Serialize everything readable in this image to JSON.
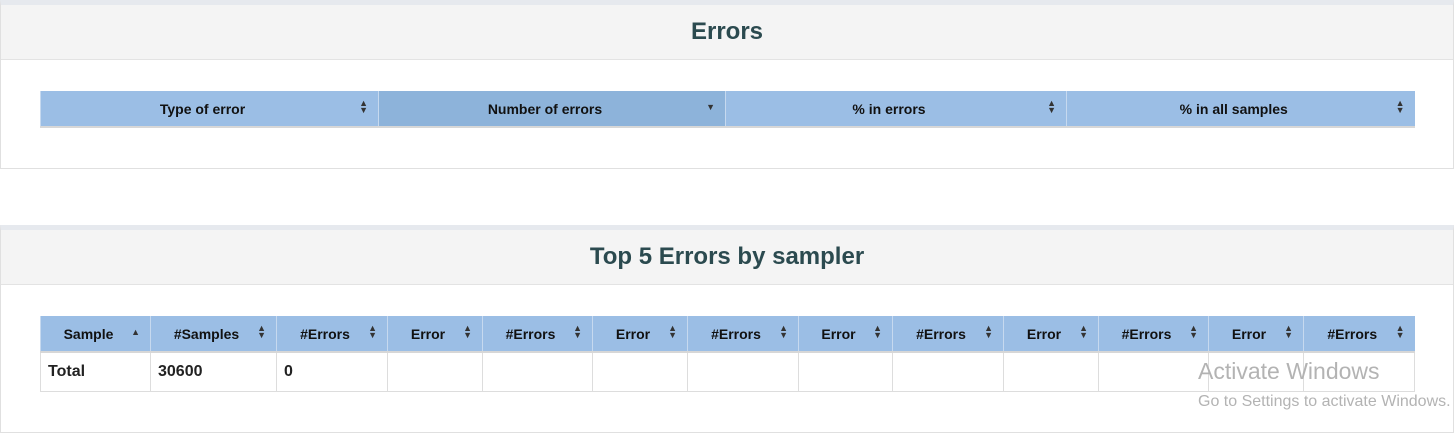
{
  "errors_panel": {
    "title": "Errors",
    "columns": [
      {
        "label": "Type of error",
        "sort": "both"
      },
      {
        "label": "Number of errors",
        "sort": "desc"
      },
      {
        "label": "% in errors",
        "sort": "both"
      },
      {
        "label": "% in all samples",
        "sort": "both"
      }
    ]
  },
  "top5_panel": {
    "title": "Top 5 Errors by sampler",
    "columns": [
      {
        "label": "Sample",
        "sort": "asc"
      },
      {
        "label": "#Samples",
        "sort": "both"
      },
      {
        "label": "#Errors",
        "sort": "both"
      },
      {
        "label": "Error",
        "sort": "both"
      },
      {
        "label": "#Errors",
        "sort": "both"
      },
      {
        "label": "Error",
        "sort": "both"
      },
      {
        "label": "#Errors",
        "sort": "both"
      },
      {
        "label": "Error",
        "sort": "both"
      },
      {
        "label": "#Errors",
        "sort": "both"
      },
      {
        "label": "Error",
        "sort": "both"
      },
      {
        "label": "#Errors",
        "sort": "both"
      },
      {
        "label": "Error",
        "sort": "both"
      },
      {
        "label": "#Errors",
        "sort": "both"
      }
    ],
    "rows": [
      [
        "Total",
        "30600",
        "0",
        "",
        "",
        "",
        "",
        "",
        "",
        "",
        "",
        "",
        ""
      ]
    ]
  },
  "watermark": {
    "line1": "Activate Windows",
    "line2": "Go to Settings to activate Windows."
  }
}
